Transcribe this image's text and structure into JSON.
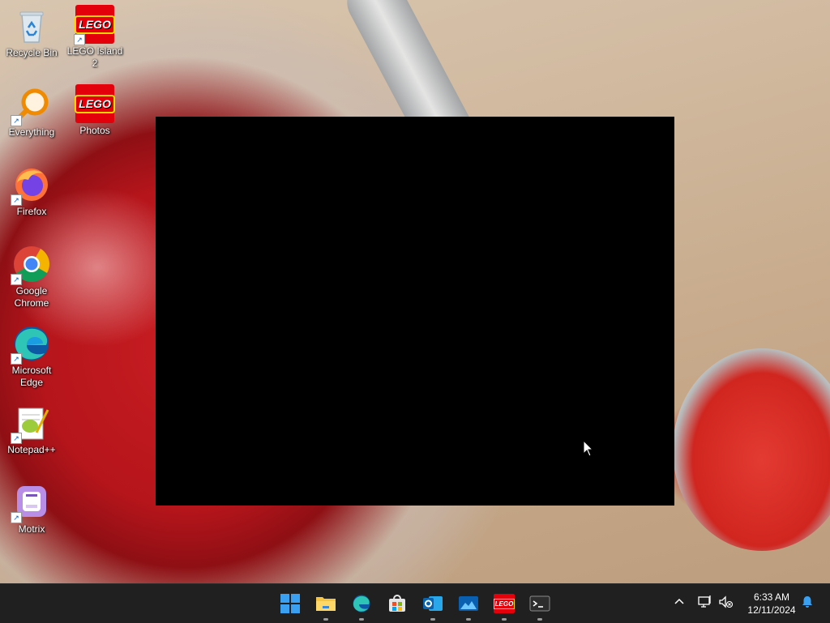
{
  "desktop": {
    "icons": [
      {
        "label": "Recycle Bin",
        "icon": "recycle-bin-icon"
      },
      {
        "label": "LEGO Island 2",
        "icon": "lego-icon",
        "logo_text": "LEGO"
      },
      {
        "label": "Everything",
        "icon": "magnifier-icon"
      },
      {
        "label": "Photos",
        "icon": "lego-icon",
        "logo_text": "LEGO"
      },
      {
        "label": "Firefox",
        "icon": "firefox-icon"
      },
      {
        "label": "Google Chrome",
        "icon": "chrome-icon"
      },
      {
        "label": "Microsoft Edge",
        "icon": "edge-icon"
      },
      {
        "label": "Notepad++",
        "icon": "notepadpp-icon"
      },
      {
        "label": "Motrix",
        "icon": "motrix-icon"
      }
    ]
  },
  "window": {
    "content": "black",
    "name": "blank black application window"
  },
  "taskbar": {
    "apps": [
      {
        "name": "start",
        "icon": "windows-start-icon",
        "running": false
      },
      {
        "name": "file-explorer",
        "icon": "folder-icon",
        "running": true
      },
      {
        "name": "edge",
        "icon": "edge-icon",
        "running": true
      },
      {
        "name": "store",
        "icon": "store-icon",
        "running": false
      },
      {
        "name": "outlook",
        "icon": "outlook-icon",
        "running": true
      },
      {
        "name": "photo-viewer",
        "icon": "photos-icon",
        "running": true
      },
      {
        "name": "lego-island",
        "icon": "lego-icon",
        "running": true
      },
      {
        "name": "terminal",
        "icon": "terminal-icon",
        "running": true
      }
    ],
    "tray": {
      "time": "6:33 AM",
      "date": "12/11/2024"
    }
  },
  "colors": {
    "taskbar_bg": "#202020",
    "lego_red": "#e3000b",
    "accent_blue": "#0078d4"
  }
}
